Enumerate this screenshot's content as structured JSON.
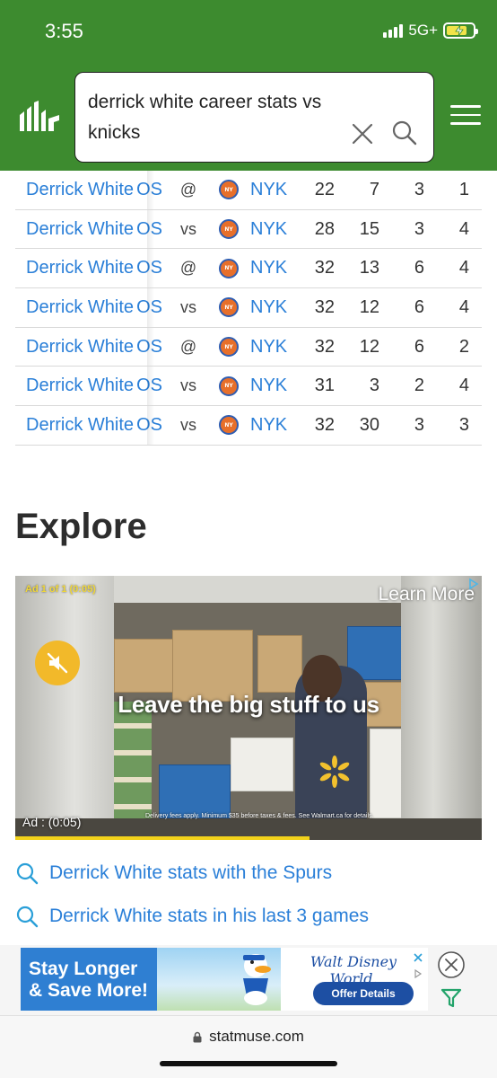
{
  "status_bar": {
    "time": "3:55",
    "network": "5G+"
  },
  "header": {
    "search_query": "derrick white career stats vs knicks",
    "logo_icon": "statmuse-logo-icon",
    "brand_color": "#3d8b2f"
  },
  "table": {
    "rows": [
      {
        "player": "Derrick White",
        "team": "OS",
        "location": "@",
        "opponent": "NYK",
        "s1": "22",
        "s2": "7",
        "s3": "3",
        "s4": "1"
      },
      {
        "player": "Derrick White",
        "team": "OS",
        "location": "vs",
        "opponent": "NYK",
        "s1": "28",
        "s2": "15",
        "s3": "3",
        "s4": "4"
      },
      {
        "player": "Derrick White",
        "team": "OS",
        "location": "@",
        "opponent": "NYK",
        "s1": "32",
        "s2": "13",
        "s3": "6",
        "s4": "4"
      },
      {
        "player": "Derrick White",
        "team": "OS",
        "location": "vs",
        "opponent": "NYK",
        "s1": "32",
        "s2": "12",
        "s3": "6",
        "s4": "4"
      },
      {
        "player": "Derrick White",
        "team": "OS",
        "location": "@",
        "opponent": "NYK",
        "s1": "32",
        "s2": "12",
        "s3": "6",
        "s4": "2"
      },
      {
        "player": "Derrick White",
        "team": "OS",
        "location": "vs",
        "opponent": "NYK",
        "s1": "31",
        "s2": "3",
        "s3": "2",
        "s4": "4"
      },
      {
        "player": "Derrick White",
        "team": "OS",
        "location": "vs",
        "opponent": "NYK",
        "s1": "32",
        "s2": "30",
        "s3": "3",
        "s4": "3"
      }
    ]
  },
  "explore": {
    "title": "Explore",
    "ad": {
      "counter": "Ad 1 of 1 (0:05)",
      "learn_more": "Learn More",
      "headline": "Leave the big stuff to us",
      "fine_print": "Delivery fees apply. Minimum $35 before taxes & fees. See Walmart.ca for details.",
      "time_label": "Ad : (0:05)",
      "progress": 0.63
    },
    "related": [
      {
        "label": "Derrick White stats with the Spurs"
      },
      {
        "label": "Derrick White stats in his last 3 games"
      }
    ]
  },
  "banner_ad": {
    "headline_line1": "Stay Longer",
    "headline_line2": "& Save More!",
    "brand": "Walt Disney World.",
    "cta": "Offer Details"
  },
  "browser": {
    "url": "statmuse.com"
  }
}
